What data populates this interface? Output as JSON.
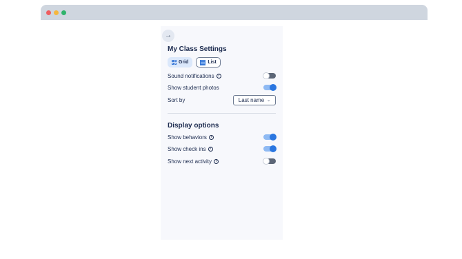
{
  "window": {
    "controls": [
      "close",
      "minimize",
      "maximize"
    ]
  },
  "panel": {
    "back_icon": "arrow-right-icon",
    "back_glyph": "→",
    "title": "My Class Settings",
    "view_toggle": {
      "grid_label": "Grid",
      "list_label": "List",
      "selected": "Grid"
    },
    "settings": [
      {
        "label": "Sound notifications",
        "has_help": true,
        "enabled": false
      },
      {
        "label": "Show student photos",
        "has_help": false,
        "enabled": true
      }
    ],
    "sort": {
      "label": "Sort by",
      "value": "Last name",
      "chevron": "⌄"
    },
    "display": {
      "title": "Display options",
      "items": [
        {
          "label": "Show behaviors",
          "has_help": true,
          "enabled": true
        },
        {
          "label": "Show check ins",
          "has_help": true,
          "enabled": true
        },
        {
          "label": "Show next activity",
          "has_help": true,
          "enabled": false
        }
      ]
    },
    "help_glyph": "?"
  },
  "colors": {
    "toggle_on": "#2a76e0",
    "toggle_off": "#5c6677",
    "text": "#1b2a4e",
    "panel_bg": "#f7f8fc"
  }
}
